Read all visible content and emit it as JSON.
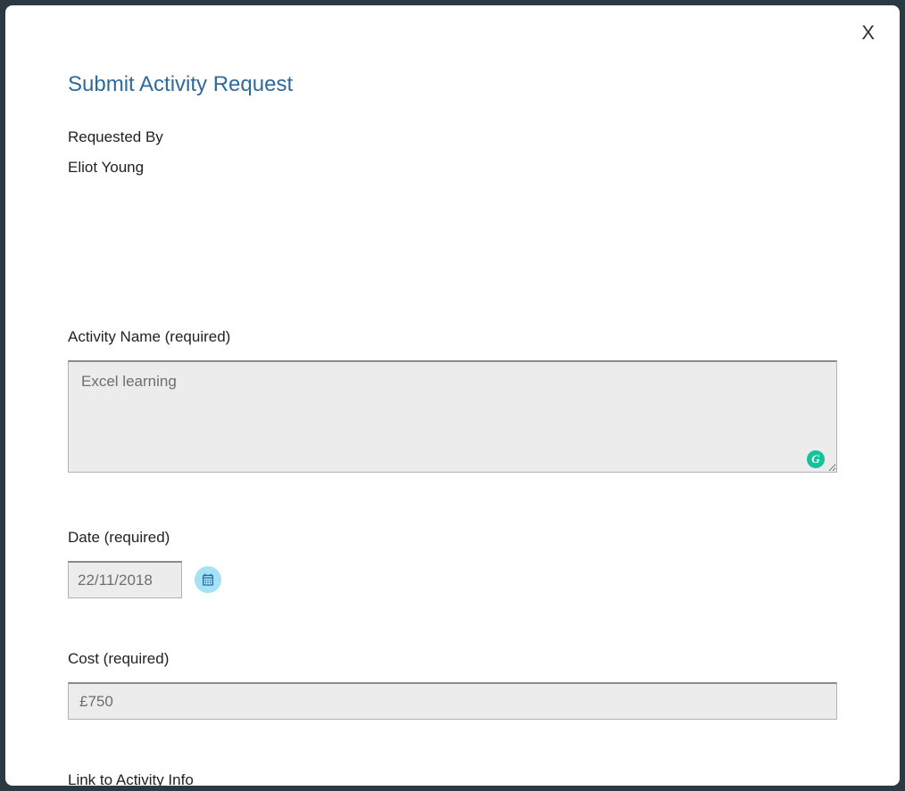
{
  "modal": {
    "title": "Submit Activity Request",
    "close": "X",
    "requested_by_label": "Requested By",
    "requested_by_value": "Eliot Young",
    "activity_name_label": "Activity Name (required)",
    "activity_name_value": "Excel learning",
    "date_label": "Date (required)",
    "date_value": "22/11/2018",
    "cost_label": "Cost (required)",
    "cost_value": "£750",
    "link_label": "Link to Activity Info",
    "grammarly_badge": "G"
  }
}
